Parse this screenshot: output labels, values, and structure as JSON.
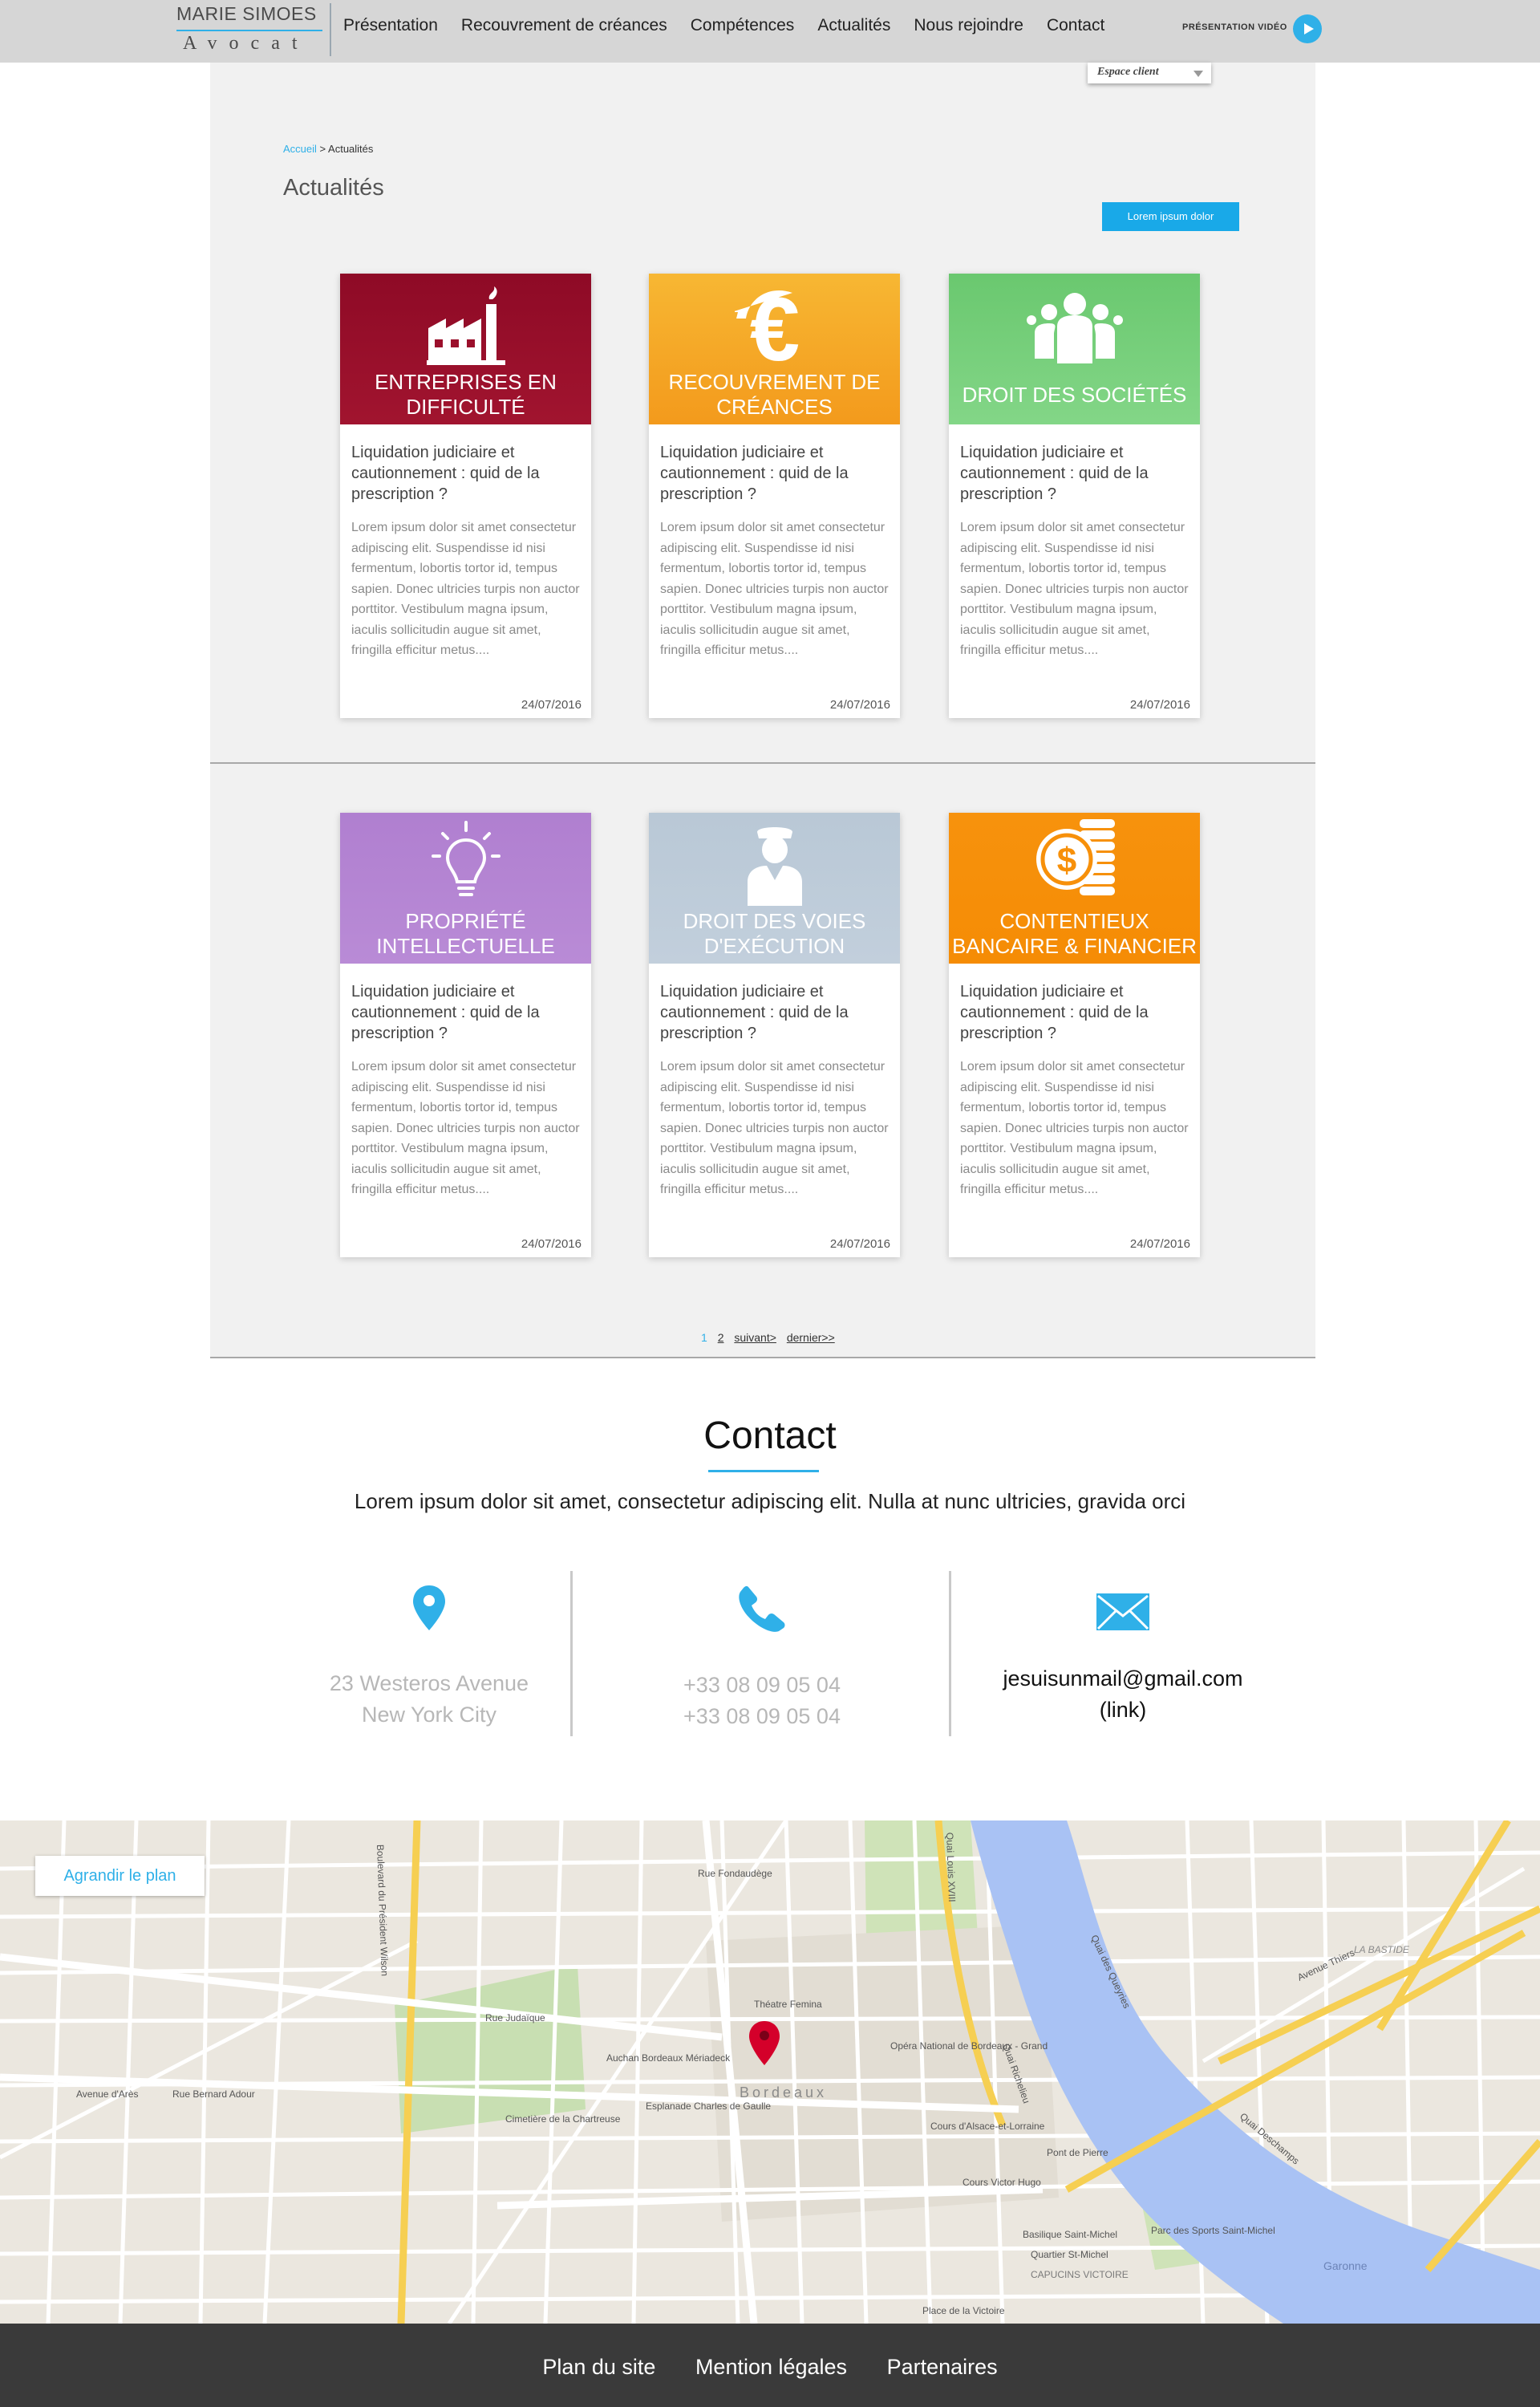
{
  "header": {
    "logo_name": "MARIE SIMOES",
    "logo_subtitle": "Avocat",
    "nav": [
      "Présentation",
      "Recouvrement de créances",
      "Compétences",
      "Actualités",
      "Nous rejoindre",
      "Contact"
    ],
    "video_label": "PRÉSENTATION VIDÉO",
    "espace_client": "Espace client"
  },
  "breadcrumb": {
    "home": "Accueil",
    "separator": " > ",
    "current": "Actualités"
  },
  "page_title": "Actualités",
  "cta_label": "Lorem ipsum dolor",
  "cards": [
    {
      "category": "ENTREPRISES EN\nDIFFICULTÉ",
      "color": "#9b0f2b",
      "icon": "factory-icon",
      "title": "Liquidation judiciaire et cautionnement : quid de la prescription ?",
      "excerpt": "Lorem ipsum dolor sit amet consectetur adipiscing elit. Suspendisse id nisi fermentum, lobortis tortor id, tempus sapien. Donec ultricies turpis non auctor porttitor. Vestibulum magna ipsum, iaculis sollicitudin augue sit amet, fringilla efficitur metus....",
      "date": "24/07/2016"
    },
    {
      "category": "RECOUVREMENT DE\nCRÉANCES",
      "color": "#f6a623",
      "icon": "euro-icon",
      "title": "Liquidation judiciaire et cautionnement : quid de la prescription ?",
      "excerpt": "Lorem ipsum dolor sit amet consectetur adipiscing elit. Suspendisse id nisi fermentum, lobortis tortor id, tempus sapien. Donec ultricies turpis non auctor porttitor. Vestibulum magna ipsum, iaculis sollicitudin augue sit amet, fringilla efficitur metus....",
      "date": "24/07/2016"
    },
    {
      "category": "DROIT DES SOCIÉTÉS",
      "color": "#6bcb71",
      "icon": "group-icon",
      "title": "Liquidation judiciaire et cautionnement : quid de la prescription ?",
      "excerpt": "Lorem ipsum dolor sit amet consectetur adipiscing elit. Suspendisse id nisi fermentum, lobortis tortor id, tempus sapien. Donec ultricies turpis non auctor porttitor. Vestibulum magna ipsum, iaculis sollicitudin augue sit amet, fringilla efficitur metus....",
      "date": "24/07/2016"
    },
    {
      "category": "PROPRIÉTÉ\nINTELLECTUELLE",
      "color": "#b183d0",
      "icon": "lightbulb-icon",
      "title": "Liquidation judiciaire et cautionnement : quid de la prescription ?",
      "excerpt": "Lorem ipsum dolor sit amet consectetur adipiscing elit. Suspendisse id nisi fermentum, lobortis tortor id, tempus sapien. Donec ultricies turpis non auctor porttitor. Vestibulum magna ipsum, iaculis sollicitudin augue sit amet, fringilla efficitur metus....",
      "date": "24/07/2016"
    },
    {
      "category": "DROIT DES VOIES\nD'EXÉCUTION",
      "color": "#bccad7",
      "icon": "officer-icon",
      "title": "Liquidation judiciaire et cautionnement : quid de la prescription ?",
      "excerpt": "Lorem ipsum dolor sit amet consectetur adipiscing elit. Suspendisse id nisi fermentum, lobortis tortor id, tempus sapien. Donec ultricies turpis non auctor porttitor. Vestibulum magna ipsum, iaculis sollicitudin augue sit amet, fringilla efficitur metus....",
      "date": "24/07/2016"
    },
    {
      "category": "CONTENTIEUX\nBANCAIRE & FINANCIER",
      "color": "#f7900a",
      "icon": "coins-icon",
      "title": "Liquidation judiciaire et cautionnement : quid de la prescription ?",
      "excerpt": "Lorem ipsum dolor sit amet consectetur adipiscing elit. Suspendisse id nisi fermentum, lobortis tortor id, tempus sapien. Donec ultricies turpis non auctor porttitor. Vestibulum magna ipsum, iaculis sollicitudin augue sit amet, fringilla efficitur metus....",
      "date": "24/07/2016"
    }
  ],
  "pagination": {
    "current": "1",
    "page2": "2",
    "next": "suivant>",
    "last": "dernier>>"
  },
  "contact": {
    "title": "Contact",
    "tagline": "Lorem ipsum dolor sit amet, consectetur adipiscing elit. Nulla at nunc ultricies, gravida orci",
    "address_line1": "23 Westeros Avenue",
    "address_line2": "New York City",
    "phone1": "+33 08 09 05 04",
    "phone2": "+33 08 09 05 04",
    "email": "jesuisunmail@gmail.com",
    "email_link": "(link)",
    "accent_color": "#2fb0e8"
  },
  "map": {
    "button_label": "Agrandir le plan",
    "labels": [
      "Bordeaux",
      "Théatre Femina",
      "Opéra National de Bordeaux - Grand",
      "Auchan Bordeaux Mériadeck",
      "Esplanade Charles de Gaulle",
      "Cimetière de la Chartreuse",
      "Basilique Saint-Michel",
      "Quartier St-Michel",
      "Parc des Sports Saint-Michel",
      "CAPUCINS VICTOIRE",
      "Place de la Victoire",
      "LA BASTIDE",
      "Pont de Pierre",
      "Garonne",
      "Cours d'Alsace-et-Lorraine",
      "Cours Victor Hugo",
      "Quai Richelieu",
      "Quai Louis XVIII",
      "Avenue Thiers",
      "Boulevard du Président Wilson",
      "Rue Judaïque",
      "Rue Fondaudège",
      "Quai des Queyries",
      "Quai Deschamps",
      "Rue Bernard Adour",
      "Avenue d'Arès"
    ],
    "water_color": "#a9c2f4",
    "road_color": "#f6cf52"
  },
  "footer": {
    "links": [
      "Plan du site",
      "Mention légales",
      "Partenaires"
    ]
  }
}
